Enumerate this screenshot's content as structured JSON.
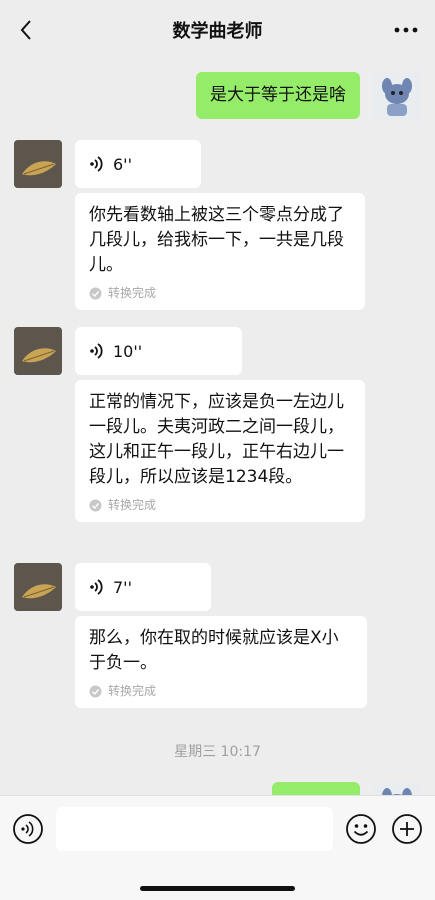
{
  "header": {
    "title": "数学曲老师"
  },
  "messages": {
    "m1": {
      "text": "是大于等于还是啥"
    },
    "m2": {
      "duration": "6''",
      "transcript": "你先看数轴上被这三个零点分成了几段儿，给我标一下，一共是几段儿。",
      "status": "转换完成"
    },
    "m3": {
      "duration": "10''",
      "transcript": "正常的情况下，应该是负一左边儿一段儿。夫夷河政二之间一段儿，这儿和正午一段儿，正午右边儿一段儿，所以应该是1234段。",
      "status": "转换完成"
    },
    "m4": {
      "duration": "7''",
      "transcript": "那么，你在取的时候就应该是X小于负一。",
      "status": "转换完成"
    },
    "timestamp": "星期三 10:17"
  },
  "colors": {
    "background": "#ededed",
    "sent_bubble": "#95ec69",
    "received_bubble": "#ffffff",
    "status_text": "#a8a8a8"
  },
  "icons": {
    "back": "chevron-left-icon",
    "more": "ellipsis-icon",
    "voice": "voice-wave-icon",
    "check": "check-circle-icon",
    "voice_toggle": "voice-input-icon",
    "emoji": "emoji-icon",
    "plus": "plus-circle-icon"
  }
}
